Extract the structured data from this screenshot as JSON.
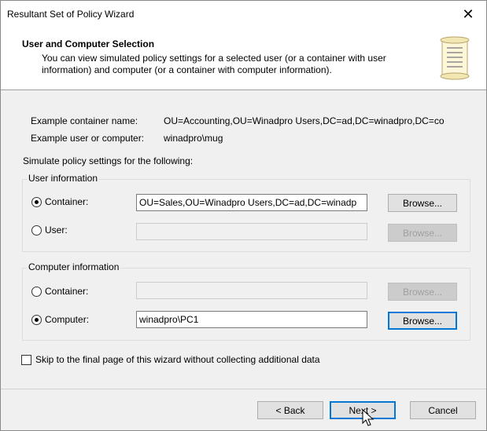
{
  "window": {
    "title": "Resultant Set of Policy Wizard",
    "close_glyph": "✕"
  },
  "header": {
    "title": "User and Computer Selection",
    "description": "You can view simulated policy settings for a selected user (or a container with user information) and computer (or a container with computer information).",
    "icon": "scroll-icon"
  },
  "examples": {
    "container_label": "Example container name:",
    "container_value": "OU=Accounting,OU=Winadpro Users,DC=ad,DC=winadpro,DC=co",
    "user_label": "Example user or computer:",
    "user_value": "winadpro\\mug"
  },
  "simulate_label": "Simulate policy settings for the following:",
  "user_info": {
    "group_title": "User information",
    "container_label": "Container:",
    "container_value": "OU=Sales,OU=Winadpro Users,DC=ad,DC=winadp",
    "container_selected": true,
    "container_browse": "Browse...",
    "user_label": "User:",
    "user_value": "",
    "user_browse": "Browse..."
  },
  "computer_info": {
    "group_title": "Computer information",
    "container_label": "Container:",
    "container_value": "",
    "container_browse": "Browse...",
    "computer_label": "Computer:",
    "computer_value": "winadpro\\PC1",
    "computer_selected": true,
    "computer_browse": "Browse..."
  },
  "skip_checkbox": {
    "label": "Skip to the final page of this wizard without collecting additional data",
    "checked": false
  },
  "footer": {
    "back_label": "< Back",
    "next_label": "Next >",
    "cancel_label": "Cancel"
  }
}
